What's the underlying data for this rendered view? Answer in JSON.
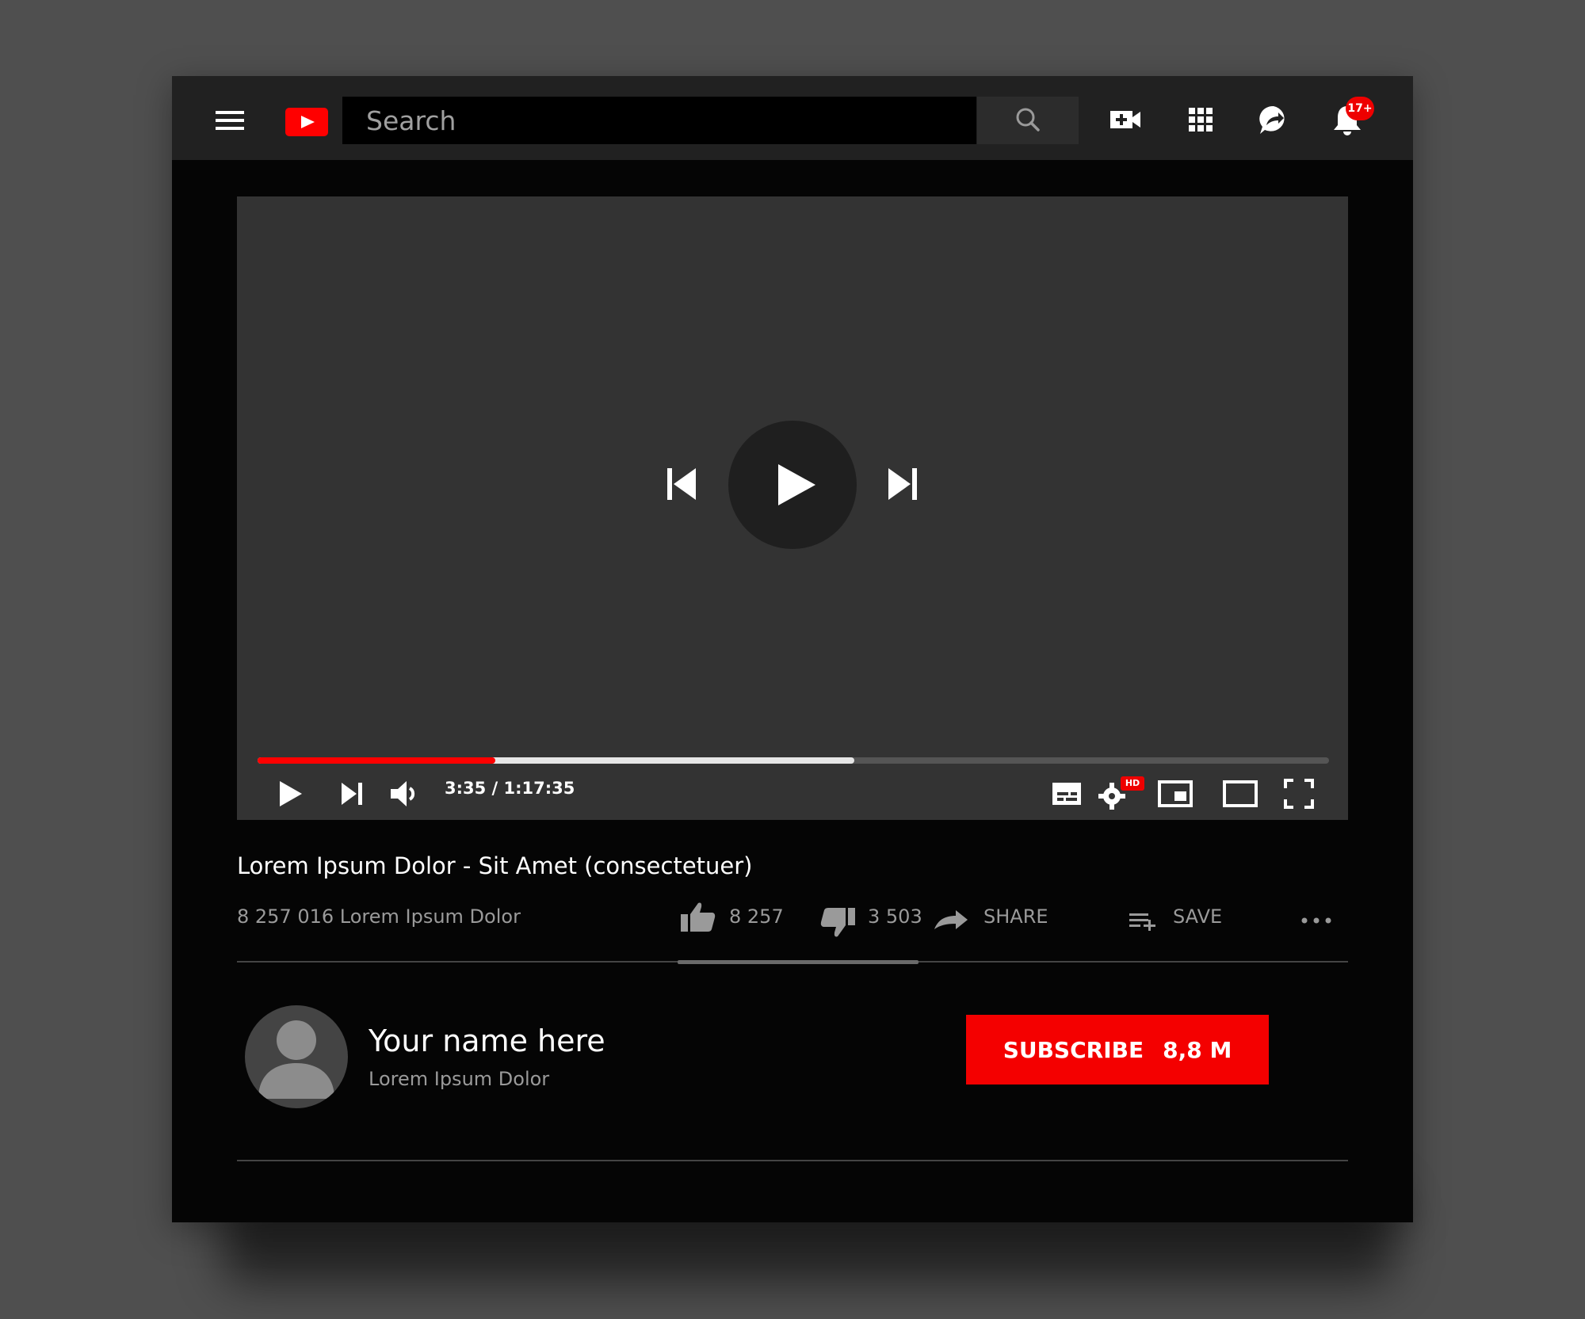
{
  "header": {
    "search_placeholder": "Search",
    "notification_count": "17+",
    "brand_color": "#ff0000"
  },
  "player": {
    "time_display": "3:35 / 1:17:35",
    "progress_played": 0.222,
    "progress_buffered": 0.557,
    "quality_badge": "HD",
    "progress_color": "#ff0000"
  },
  "video": {
    "title": "Lorem Ipsum Dolor - Sit Amet (consectetuer)",
    "views": "8 257 016 Lorem Ipsum Dolor",
    "likes": "8 257",
    "dislikes": "3 503",
    "share_label": "SHARE",
    "save_label": "SAVE"
  },
  "channel": {
    "name": "Your name here",
    "subtitle": "Lorem Ipsum Dolor",
    "subscribe_label": "SUBSCRIBE",
    "subscriber_count": "8,8 M"
  }
}
